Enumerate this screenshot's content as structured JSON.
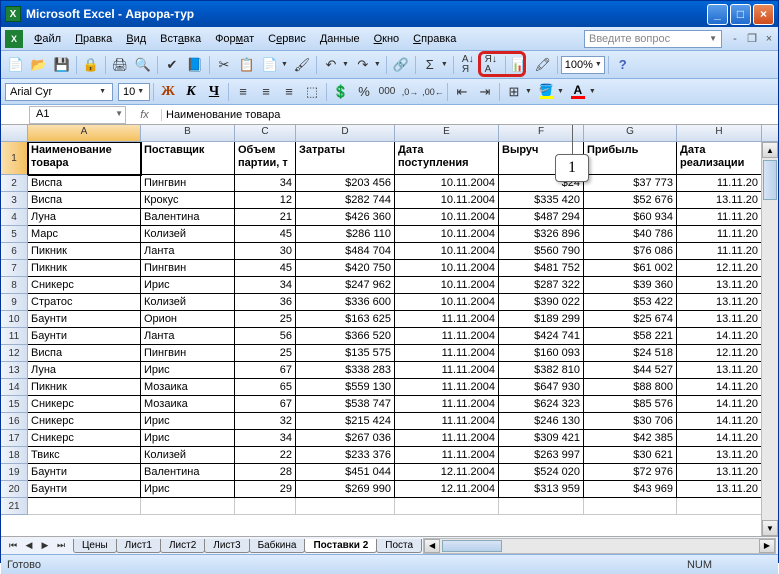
{
  "titlebar": {
    "app": "Microsoft Excel",
    "doc": "Аврора-тур"
  },
  "menu": {
    "file": "Файл",
    "edit": "Правка",
    "view": "Вид",
    "insert": "Вставка",
    "format": "Формат",
    "tools": "Сервис",
    "data": "Данные",
    "window": "Окно",
    "help": "Справка",
    "question_placeholder": "Введите вопрос"
  },
  "toolbar": {
    "zoom": "100%"
  },
  "format_bar": {
    "font": "Arial Cyr",
    "size": "10",
    "bold": "Ж",
    "italic": "К",
    "underline": "Ч"
  },
  "formula_bar": {
    "cell_ref": "A1",
    "fx": "fx",
    "value": "Наименование товара"
  },
  "callout": {
    "label": "1"
  },
  "columns": [
    "A",
    "B",
    "C",
    "D",
    "E",
    "F",
    "G",
    "H"
  ],
  "headers": {
    "A": "Наименование товара",
    "B": "Поставщик",
    "C": "Объем партии, т",
    "D": "Затраты",
    "E": "Дата поступления",
    "F": "Выруч",
    "G": "Прибыль",
    "H": "Дата реализации"
  },
  "rows": [
    {
      "n": 2,
      "A": "Виспа",
      "B": "Пингвин",
      "C": "34",
      "D": "$203 456",
      "E": "10.11.2004",
      "F": "$24",
      "G": "$37 773",
      "H": "11.11.20"
    },
    {
      "n": 3,
      "A": "Виспа",
      "B": "Крокус",
      "C": "12",
      "D": "$282 744",
      "E": "10.11.2004",
      "F": "$335 420",
      "G": "$52 676",
      "H": "13.11.20"
    },
    {
      "n": 4,
      "A": "Луна",
      "B": "Валентина",
      "C": "21",
      "D": "$426 360",
      "E": "10.11.2004",
      "F": "$487 294",
      "G": "$60 934",
      "H": "11.11.20"
    },
    {
      "n": 5,
      "A": "Марс",
      "B": "Колизей",
      "C": "45",
      "D": "$286 110",
      "E": "10.11.2004",
      "F": "$326 896",
      "G": "$40 786",
      "H": "11.11.20"
    },
    {
      "n": 6,
      "A": "Пикник",
      "B": "Ланта",
      "C": "30",
      "D": "$484 704",
      "E": "10.11.2004",
      "F": "$560 790",
      "G": "$76 086",
      "H": "11.11.20"
    },
    {
      "n": 7,
      "A": "Пикник",
      "B": "Пингвин",
      "C": "45",
      "D": "$420 750",
      "E": "10.11.2004",
      "F": "$481 752",
      "G": "$61 002",
      "H": "12.11.20"
    },
    {
      "n": 8,
      "A": "Сникерс",
      "B": "Ирис",
      "C": "34",
      "D": "$247 962",
      "E": "10.11.2004",
      "F": "$287 322",
      "G": "$39 360",
      "H": "13.11.20"
    },
    {
      "n": 9,
      "A": "Стратос",
      "B": "Колизей",
      "C": "36",
      "D": "$336 600",
      "E": "10.11.2004",
      "F": "$390 022",
      "G": "$53 422",
      "H": "13.11.20"
    },
    {
      "n": 10,
      "A": "Баунти",
      "B": "Орион",
      "C": "25",
      "D": "$163 625",
      "E": "11.11.2004",
      "F": "$189 299",
      "G": "$25 674",
      "H": "13.11.20"
    },
    {
      "n": 11,
      "A": "Баунти",
      "B": "Ланта",
      "C": "56",
      "D": "$366 520",
      "E": "11.11.2004",
      "F": "$424 741",
      "G": "$58 221",
      "H": "14.11.20"
    },
    {
      "n": 12,
      "A": "Виспа",
      "B": "Пингвин",
      "C": "25",
      "D": "$135 575",
      "E": "11.11.2004",
      "F": "$160 093",
      "G": "$24 518",
      "H": "12.11.20"
    },
    {
      "n": 13,
      "A": "Луна",
      "B": "Ирис",
      "C": "67",
      "D": "$338 283",
      "E": "11.11.2004",
      "F": "$382 810",
      "G": "$44 527",
      "H": "13.11.20"
    },
    {
      "n": 14,
      "A": "Пикник",
      "B": "Мозаика",
      "C": "65",
      "D": "$559 130",
      "E": "11.11.2004",
      "F": "$647 930",
      "G": "$88 800",
      "H": "14.11.20"
    },
    {
      "n": 15,
      "A": "Сникерс",
      "B": "Мозаика",
      "C": "67",
      "D": "$538 747",
      "E": "11.11.2004",
      "F": "$624 323",
      "G": "$85 576",
      "H": "14.11.20"
    },
    {
      "n": 16,
      "A": "Сникерс",
      "B": "Ирис",
      "C": "32",
      "D": "$215 424",
      "E": "11.11.2004",
      "F": "$246 130",
      "G": "$30 706",
      "H": "14.11.20"
    },
    {
      "n": 17,
      "A": "Сникерс",
      "B": "Ирис",
      "C": "34",
      "D": "$267 036",
      "E": "11.11.2004",
      "F": "$309 421",
      "G": "$42 385",
      "H": "14.11.20"
    },
    {
      "n": 18,
      "A": "Твикс",
      "B": "Колизей",
      "C": "22",
      "D": "$233 376",
      "E": "11.11.2004",
      "F": "$263 997",
      "G": "$30 621",
      "H": "13.11.20"
    },
    {
      "n": 19,
      "A": "Баунти",
      "B": "Валентина",
      "C": "28",
      "D": "$451 044",
      "E": "12.11.2004",
      "F": "$524 020",
      "G": "$72 976",
      "H": "13.11.20"
    },
    {
      "n": 20,
      "A": "Баунти",
      "B": "Ирис",
      "C": "29",
      "D": "$269 990",
      "E": "12.11.2004",
      "F": "$313 959",
      "G": "$43 969",
      "H": "13.11.20"
    }
  ],
  "sheets": {
    "tabs": [
      "Цены",
      "Лист1",
      "Лист2",
      "Лист3",
      "Бабкина",
      "Поставки 2",
      "Поста"
    ],
    "active": "Поставки 2"
  },
  "status": {
    "ready": "Готово",
    "num": "NUM"
  }
}
